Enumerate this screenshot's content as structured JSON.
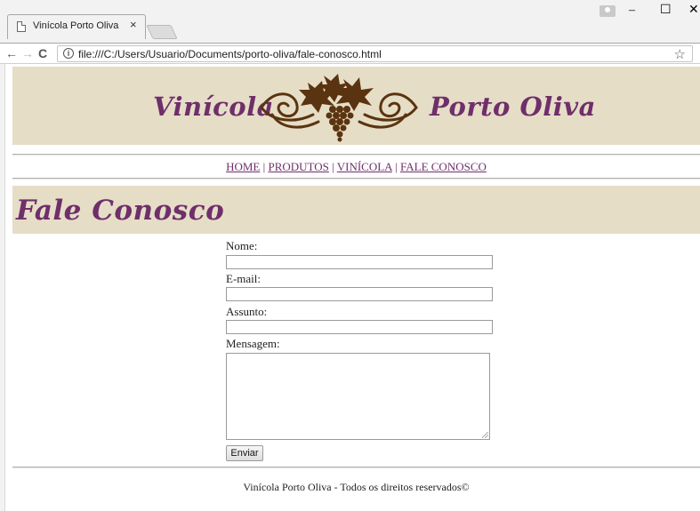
{
  "browser": {
    "tab_title": "Vinícola Porto Oliva",
    "tab_close": "×",
    "url": "file:///C:/Users/Usuario/Documents/porto-oliva/fale-conosco.html",
    "icons": {
      "back": "arrow-left-icon",
      "forward": "arrow-right-icon",
      "reload": "reload-icon",
      "info": "info-icon",
      "bookmark": "star-icon",
      "minimize": "minimize-icon",
      "maximize": "maximize-icon",
      "close": "close-icon"
    }
  },
  "header": {
    "brand_left": "Vinícola",
    "brand_right": "Porto Oliva",
    "logo": "grape-vine-logo"
  },
  "nav": {
    "items": [
      "HOME",
      "PRODUTOS",
      "VINÍCOLA",
      "FALE CONOSCO"
    ],
    "separator": "|"
  },
  "section": {
    "title": "Fale Conosco"
  },
  "form": {
    "nome_label": "Nome:",
    "nome_value": "",
    "email_label": "E-mail:",
    "email_value": "",
    "assunto_label": "Assunto:",
    "assunto_value": "",
    "mensagem_label": "Mensagem:",
    "mensagem_value": "",
    "submit_label": "Enviar"
  },
  "footer": {
    "text": "Vinícola Porto Oliva - Todos os direitos reservados©"
  },
  "colors": {
    "accent_purple": "#6f2f6a",
    "banner_beige": "#e6ddc6",
    "logo_brown": "#5a3410"
  }
}
